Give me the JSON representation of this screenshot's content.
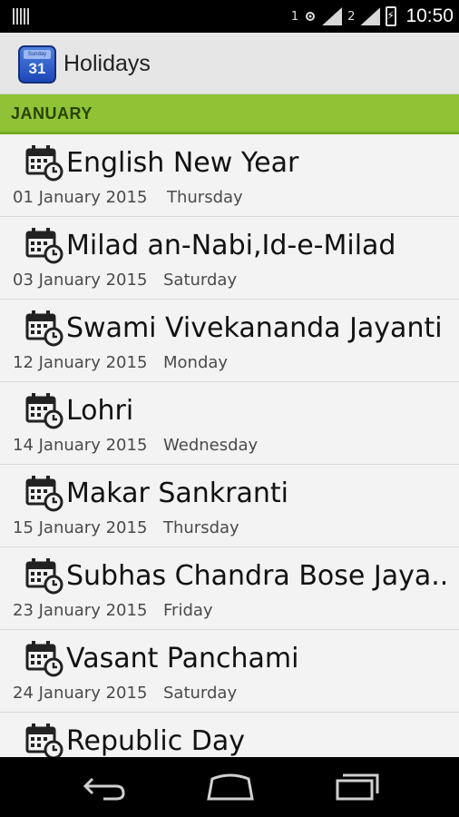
{
  "status_bar": {
    "sim1": "1",
    "sim2": "2",
    "time": "10:50",
    "icons": [
      "sim-card-icon",
      "signal-icon",
      "battery-charging-icon"
    ]
  },
  "app": {
    "title": "Holidays",
    "icon_number": "31"
  },
  "section": {
    "label": "JANUARY",
    "color": "#8fc335"
  },
  "holidays": [
    {
      "name": "English New Year",
      "date": "01 January 2015",
      "day": "Thursday"
    },
    {
      "name": "Milad an-Nabi,Id-e-Milad",
      "date": "03 January 2015",
      "day": "Saturday"
    },
    {
      "name": "Swami Vivekananda Jayanti",
      "date": "12 January 2015",
      "day": "Monday"
    },
    {
      "name": "Lohri",
      "date": "14 January 2015",
      "day": "Wednesday"
    },
    {
      "name": "Makar Sankranti",
      "date": "15 January 2015",
      "day": "Thursday"
    },
    {
      "name": "Subhas Chandra Bose Jaya..",
      "date": "23 January 2015",
      "day": "Friday"
    },
    {
      "name": "Vasant Panchami",
      "date": "24 January 2015",
      "day": "Saturday"
    },
    {
      "name": "Republic Day",
      "date": "",
      "day": ""
    }
  ],
  "nav": {
    "icons": [
      "back-icon",
      "home-icon",
      "recents-icon"
    ]
  }
}
